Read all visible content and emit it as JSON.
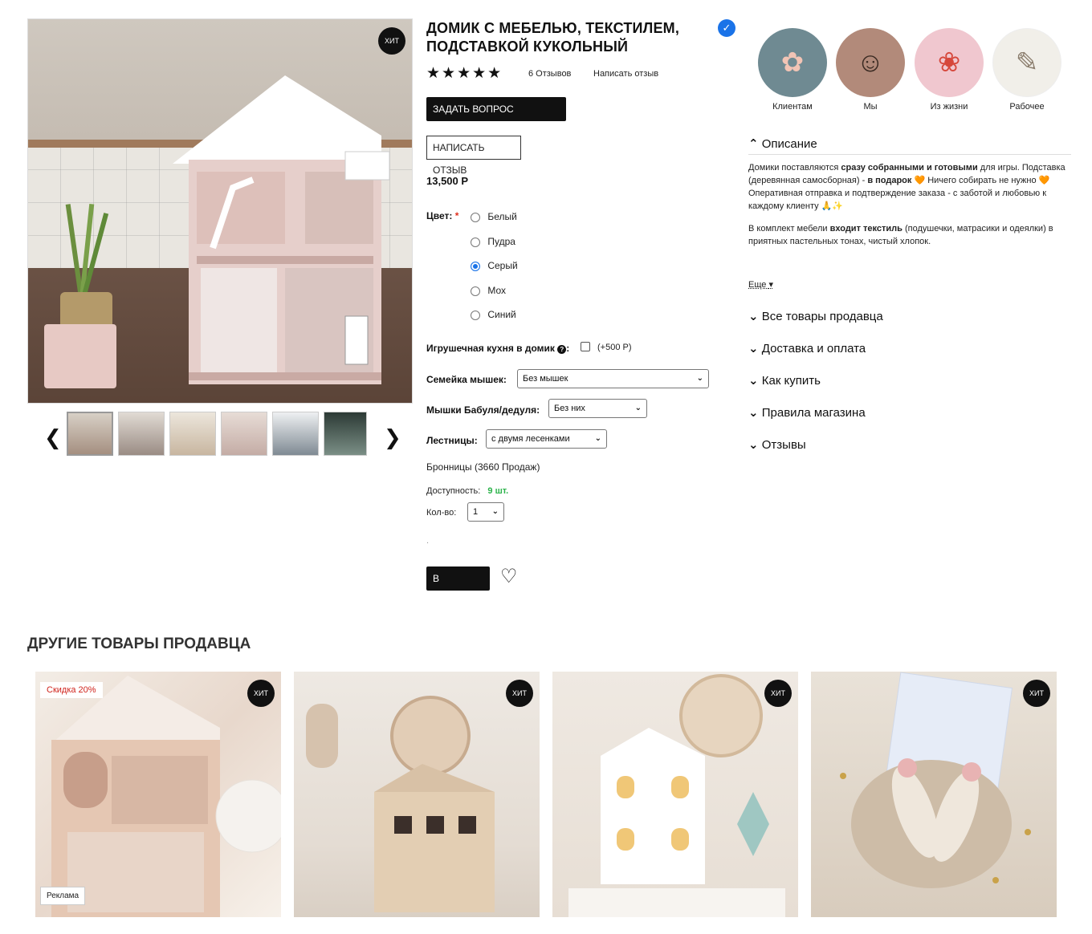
{
  "gallery": {
    "badge": "ХИТ",
    "prev_icon": "❮",
    "next_icon": "❯",
    "thumb_count": 6
  },
  "product": {
    "title": "ДОМИК С МЕБЕЛЬЮ, ТЕКСТИЛЕМ, ПОДСТАВКОЙ КУКОЛЬНЫЙ",
    "rating_stars": "★★★★★",
    "rating": 5,
    "reviews_count_label": "6 Отзывов",
    "write_review_link": "Написать отзыв",
    "ask_seller_button": "ЗАДАТЬ ВОПРОС ПРОДАВЦУ",
    "write_review_button": "НАПИСАТЬ ОТЗЫВ",
    "price": "13,500 Р",
    "color_label": "Цвет:",
    "required_mark": "*",
    "colors": [
      "Белый",
      "Пудра",
      "Серый",
      "Мох",
      "Синий"
    ],
    "selected_color": "Серый",
    "kitchen_label": "Игрушечная кухня в домик",
    "kitchen_help": "?",
    "kitchen_price": "(+500 Р)",
    "mice_family_label": "Семейка мышек:",
    "mice_family_value": "Без мышек",
    "grandparents_label": "Мышки Бабуля/дедуля:",
    "grandparents_value": "Без них",
    "stairs_label": "Лестницы:",
    "stairs_value": "с двумя лесенками",
    "seller_line": "Бронницы (3660 Продаж)",
    "availability_label": "Доступность:",
    "availability_value": "9 шт.",
    "qty_label": "Кол-во:",
    "qty_value": "1",
    "dot": ".",
    "cart_button": "В КОРЗИНУ",
    "wishlist_icon": "♡"
  },
  "stories": [
    {
      "label": "Клиентам",
      "bg": "#6f8a92",
      "icon": "✿"
    },
    {
      "label": "Мы",
      "bg": "#b28a7a",
      "icon": "☺"
    },
    {
      "label": "Из жизни",
      "bg": "#f0c7cf",
      "icon": "❀"
    },
    {
      "label": "Рабочее",
      "bg": "#f1efe9",
      "icon": "✎"
    }
  ],
  "accordion": {
    "description_title": "Описание",
    "desc_p1_a": "Домики поставляются ",
    "desc_p1_b": "сразу собранными и готовыми",
    "desc_p1_c": " для игры. Подставка (деревянная самосборная) - ",
    "desc_p1_d": "в подарок",
    "desc_p1_e": " 🧡 Ничего собирать не нужно 🧡 Оперативная отправка и подтверждение заказа - с заботой и любовью к каждому клиенту 🙏✨",
    "desc_p2_a": "В комплект мебели ",
    "desc_p2_b": "входит текстиль",
    "desc_p2_c": " (подушечки, матрасики и одеялки) в приятных пастельных тонах, чистый хлопок.",
    "more_link": "Еще",
    "sections": [
      "Все товары продавца",
      "Доставка и оплата",
      "Как купить",
      "Правила магазина",
      "Отзывы"
    ],
    "open_icon": "⌃",
    "closed_icon": "⌄"
  },
  "other": {
    "title": "ДРУГИЕ ТОВАРЫ ПРОДАВЦА",
    "discount_badge": "Скидка 20%",
    "ad_badge": "Реклама",
    "hit_badge": "ХИТ"
  },
  "colors": {
    "accent_blue": "#1a73e8",
    "availability_green": "#2bb34a",
    "discount_red": "#d0231b"
  }
}
